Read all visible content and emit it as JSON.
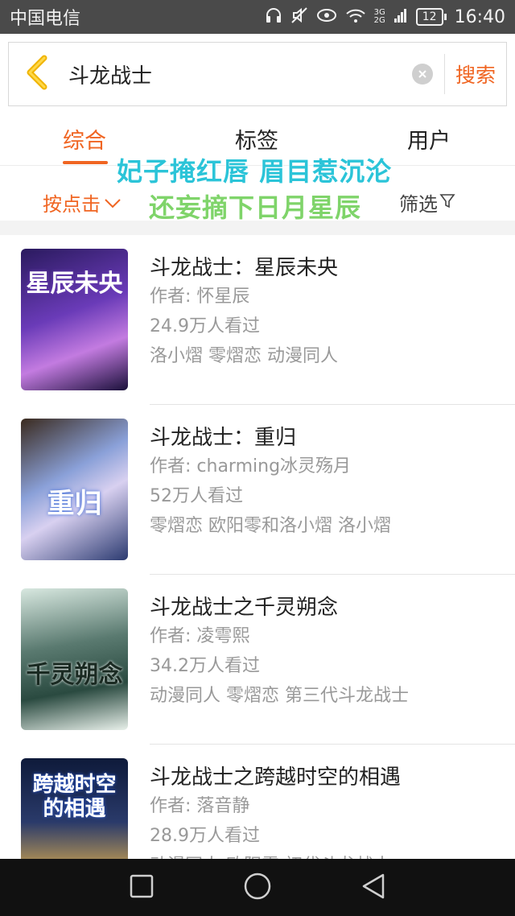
{
  "status": {
    "carrier": "中国电信",
    "network_top": "3G",
    "network_bottom": "2G",
    "battery": "12",
    "time": "16:40"
  },
  "search": {
    "query": "斗龙战士",
    "button_label": "搜索"
  },
  "tabs": [
    {
      "label": "综合",
      "active": true
    },
    {
      "label": "标签",
      "active": false
    },
    {
      "label": "用户",
      "active": false
    }
  ],
  "overlay": {
    "line1": "妃子掩红唇 眉目惹沉沦",
    "line2": "还妄摘下日月星辰"
  },
  "filterbar": {
    "sort_label": "按点击",
    "filter_label": "筛选"
  },
  "books": [
    {
      "title": "斗龙战士：星辰未央",
      "author": "作者: 怀星辰",
      "views": "24.9万人看过",
      "tags": "洛小熠 零熠恋 动漫同人",
      "cover_text": "星辰未央"
    },
    {
      "title": "斗龙战士：重归",
      "author": "作者: charming冰灵殇月",
      "views": "52万人看过",
      "tags": "零熠恋 欧阳零和洛小熠 洛小熠",
      "cover_text": "重归"
    },
    {
      "title": "斗龙战士之千灵朔念",
      "author": "作者: 凌雩熙",
      "views": "34.2万人看过",
      "tags": "动漫同人 零熠恋 第三代斗龙战士",
      "cover_text": "千灵朔念"
    },
    {
      "title": "斗龙战士之跨越时空的相遇",
      "author": "作者: 落音静",
      "views": "28.9万人看过",
      "tags": "动漫同人 欧阳零 初代斗龙战士",
      "cover_text": "跨越时空的相遇"
    }
  ],
  "colors": {
    "accent": "#f06522",
    "status_bar": "#4a4a4a",
    "nav_bar": "#111111"
  }
}
